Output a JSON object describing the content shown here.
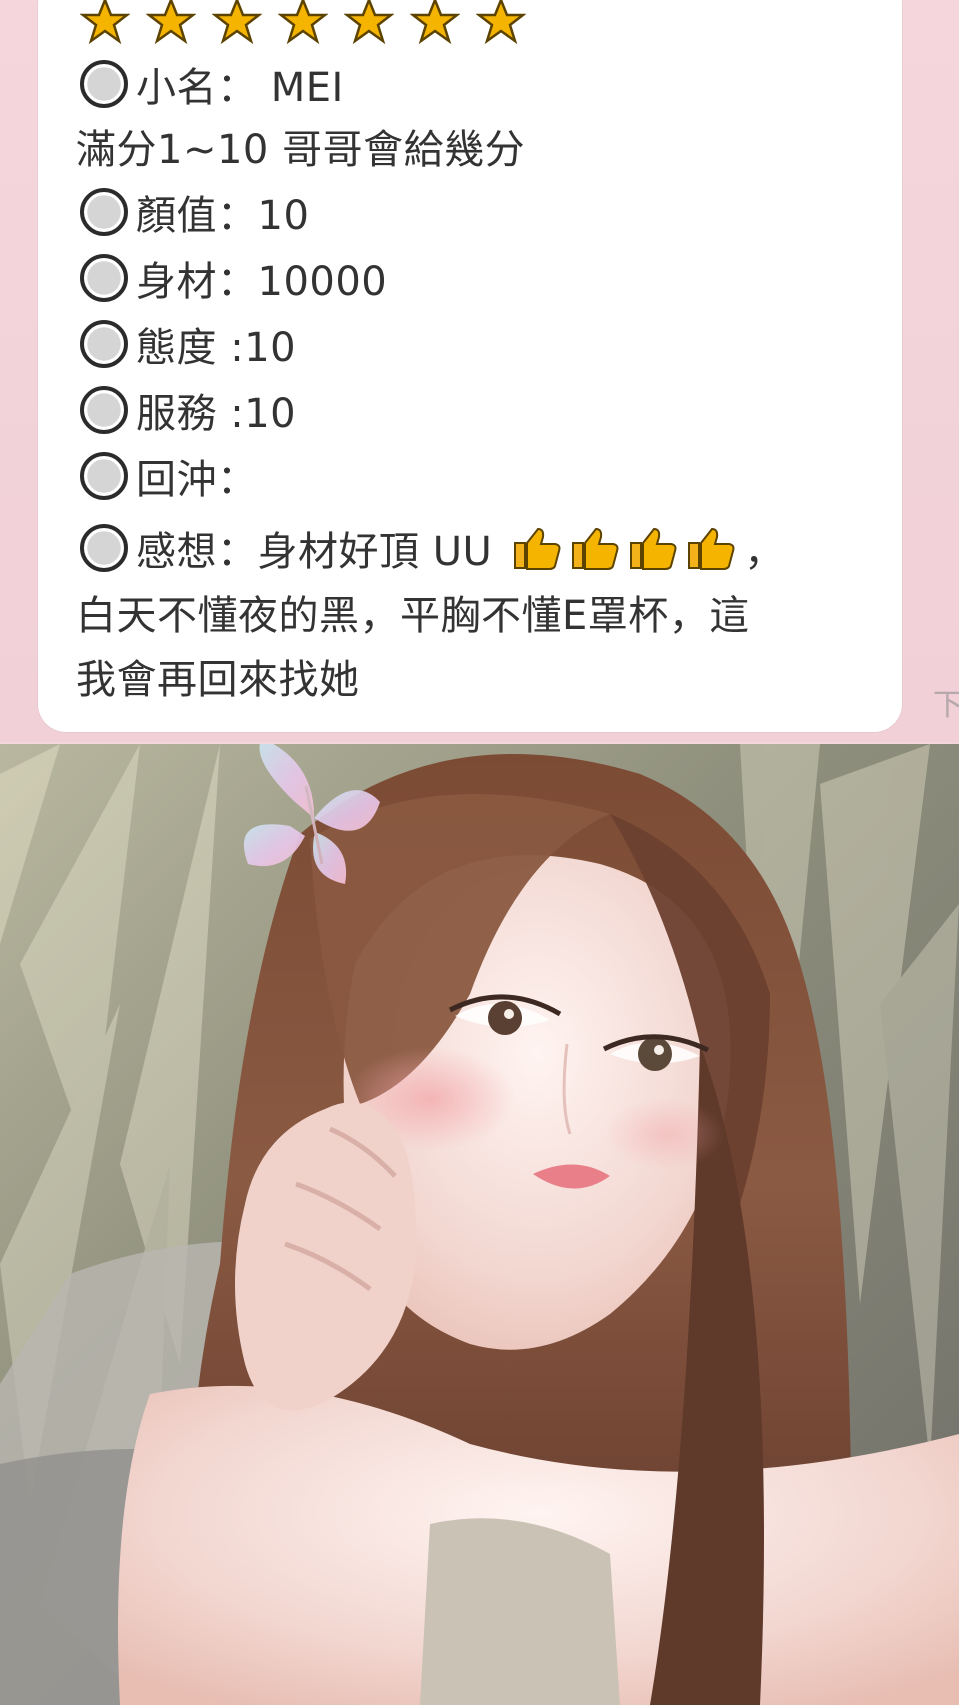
{
  "chat": {
    "stars_count": 7,
    "name_line": "小名： MEI",
    "rating_line": "滿分1~10 哥哥會給幾分",
    "scores": [
      "顏值：10",
      "身材：10000",
      "態度 :10",
      "服務 :10",
      "回沖："
    ],
    "impression_label": "感想：身材好頂 UU",
    "impression_comma": "，",
    "impression_line_2": "白天不懂夜的黑，平胸不懂E罩杯，這",
    "impression_line_3": "我會再回來找她",
    "side_char": "下"
  },
  "colors": {
    "background_pink": "#f3d7dc",
    "bubble_white": "#ffffff",
    "text_dark": "#333333",
    "star_yellow": "#f5b400"
  },
  "icons": {
    "star": "star-icon",
    "radio": "radio-icon",
    "thumbs_up": "thumbs-up-icon",
    "photo": "portrait-photo"
  }
}
